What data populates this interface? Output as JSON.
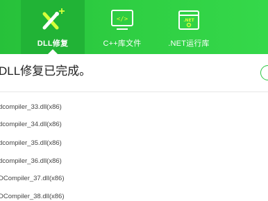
{
  "tabs": [
    {
      "label": "DLL修复",
      "icon": "tools-icon",
      "active": true
    },
    {
      "label": "C++库文件",
      "icon": "code-icon",
      "active": false
    },
    {
      "label": ".NET运行库",
      "icon": "dotnet-icon",
      "active": false
    }
  ],
  "status": {
    "text": "DLL修复已完成。"
  },
  "files": [
    "dcompiler_33.dll(x86)",
    "dcompiler_34.dll(x86)",
    "dcompiler_35.dll(x86)",
    "dcompiler_36.dll(x86)",
    "DCompiler_37.dll(x86)",
    "DCompiler_38.dll(x86)"
  ],
  "colors": {
    "brand_green": "#2fcf43",
    "active_tab": "#21b336"
  }
}
